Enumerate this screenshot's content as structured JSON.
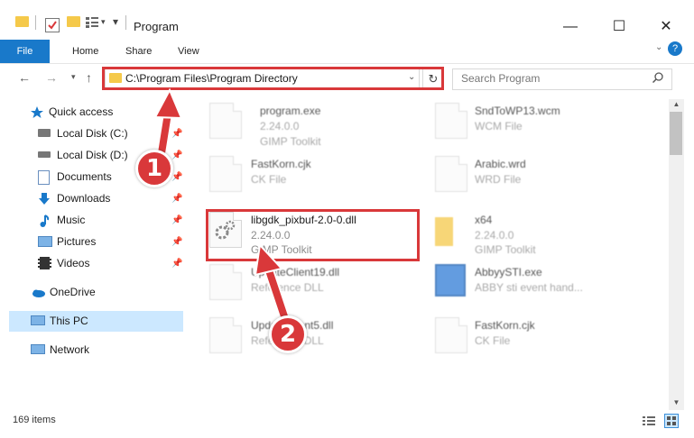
{
  "window": {
    "title": "Program",
    "minimize": "—",
    "maximize": "☐",
    "close": "✕",
    "help": "?"
  },
  "ribbon": {
    "tabs": [
      "File",
      "Home",
      "Share",
      "View"
    ]
  },
  "address": {
    "path": "C:\\Program Files\\Program Directory",
    "search_placeholder": "Search Program"
  },
  "nav": {
    "items": [
      {
        "label": "Quick access",
        "icon": "star-icon",
        "pinned": false
      },
      {
        "label": "Local Disk (C:)",
        "icon": "drive-icon",
        "pinned": true
      },
      {
        "label": "Local Disk (D:)",
        "icon": "drive-icon",
        "pinned": true
      },
      {
        "label": "Documents",
        "icon": "documents-icon",
        "pinned": true
      },
      {
        "label": "Downloads",
        "icon": "download-icon",
        "pinned": true
      },
      {
        "label": "Music",
        "icon": "music-icon",
        "pinned": true
      },
      {
        "label": "Pictures",
        "icon": "pictures-icon",
        "pinned": true
      },
      {
        "label": "Videos",
        "icon": "videos-icon",
        "pinned": true
      },
      {
        "label": "OneDrive",
        "icon": "cloud-icon",
        "pinned": false
      },
      {
        "label": "This PC",
        "icon": "computer-icon",
        "pinned": false
      },
      {
        "label": "Network",
        "icon": "network-icon",
        "pinned": false
      }
    ]
  },
  "files": [
    {
      "name": "program.exe",
      "line1": "2.24.0.0",
      "line2": "GIMP Toolkit"
    },
    {
      "name": "SndToWP13.wcm",
      "line1": "WCM File",
      "line2": ""
    },
    {
      "name": "FastKorn.cjk",
      "line1": "CK File",
      "line2": ""
    },
    {
      "name": "Arabic.wrd",
      "line1": "WRD File",
      "line2": ""
    },
    {
      "name": "libgdk_pixbuf-2.0-0.dll",
      "line1": "2.24.0.0",
      "line2": "GIMP Toolkit"
    },
    {
      "name": "x64",
      "line1": "2.24.0.0",
      "line2": "GIMP Toolkit"
    },
    {
      "name": "UpdateClient19.dll",
      "line1": "Reference DLL",
      "line2": ""
    },
    {
      "name": "AbbyySTI.exe",
      "line1": "ABBY sti event hand...",
      "line2": ""
    },
    {
      "name": "UpdateClient5.dll",
      "line1": "Reference DLL",
      "line2": ""
    },
    {
      "name": "FastKorn.cjk",
      "line1": "CK File",
      "line2": ""
    }
  ],
  "status": {
    "count": "169 items"
  },
  "callouts": {
    "one": "1",
    "two": "2"
  },
  "colors": {
    "accent": "#1979ca",
    "highlight": "#d9383a",
    "selection": "#cce8ff"
  }
}
